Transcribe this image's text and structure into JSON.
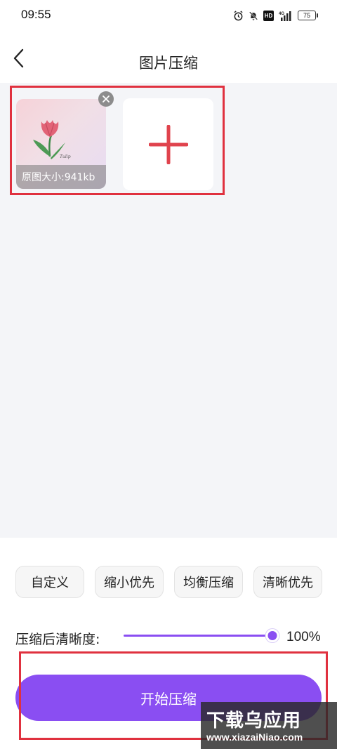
{
  "status_bar": {
    "time": "09:55",
    "network": "4G",
    "hd_badge": "HD",
    "battery": "75"
  },
  "header": {
    "title": "图片压缩",
    "back_icon": "chevron-left-icon"
  },
  "images": {
    "thumbnail_caption": "原图大小:941kb",
    "remove_icon": "close-icon",
    "add_icon": "plus-icon"
  },
  "presets": [
    {
      "label": "自定义"
    },
    {
      "label": "缩小优先"
    },
    {
      "label": "均衡压缩"
    },
    {
      "label": "清晰优先"
    }
  ],
  "quality": {
    "label": "压缩后清晰度:",
    "value_text": "100%",
    "value": 100
  },
  "actions": {
    "start_label": "开始压缩"
  },
  "watermark": {
    "main": "下载乌应用",
    "sub": "www.xiazaiNiao.com"
  },
  "colors": {
    "accent": "#8a4ef2",
    "highlight_red": "#e0313f",
    "plus_red": "#e0434d"
  }
}
